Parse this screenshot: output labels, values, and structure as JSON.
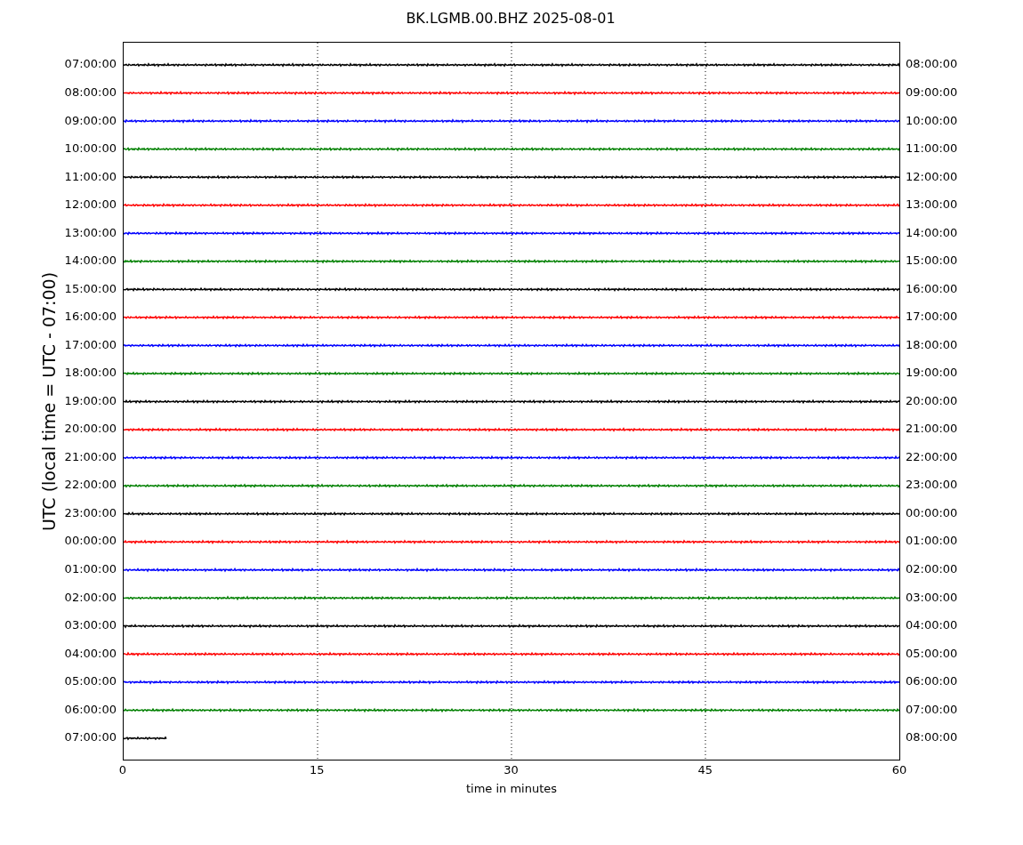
{
  "title": "BK.LGMB.00.BHZ 2025-08-01",
  "ylabel": "UTC (local time = UTC - 07:00)",
  "xlabel": "time in minutes",
  "xticks": [
    "0",
    "15",
    "30",
    "45",
    "60"
  ],
  "traces": [
    {
      "left": "07:00:00",
      "right": "08:00:00",
      "color": "#000000",
      "level": 1
    },
    {
      "left": "08:00:00",
      "right": "09:00:00",
      "color": "#ff0000",
      "level": 1
    },
    {
      "left": "09:00:00",
      "right": "10:00:00",
      "color": "#0000ff",
      "level": 1
    },
    {
      "left": "10:00:00",
      "right": "11:00:00",
      "color": "#008000",
      "level": 1
    },
    {
      "left": "11:00:00",
      "right": "12:00:00",
      "color": "#000000",
      "level": 1
    },
    {
      "left": "12:00:00",
      "right": "13:00:00",
      "color": "#ff0000",
      "level": 1
    },
    {
      "left": "13:00:00",
      "right": "14:00:00",
      "color": "#0000ff",
      "level": 1
    },
    {
      "left": "14:00:00",
      "right": "15:00:00",
      "color": "#008000",
      "level": 1
    },
    {
      "left": "15:00:00",
      "right": "16:00:00",
      "color": "#000000",
      "level": 1
    },
    {
      "left": "16:00:00",
      "right": "17:00:00",
      "color": "#ff0000",
      "level": 1
    },
    {
      "left": "17:00:00",
      "right": "18:00:00",
      "color": "#0000ff",
      "level": 1
    },
    {
      "left": "18:00:00",
      "right": "19:00:00",
      "color": "#008000",
      "level": 1
    },
    {
      "left": "19:00:00",
      "right": "20:00:00",
      "color": "#000000",
      "level": 1
    },
    {
      "left": "20:00:00",
      "right": "21:00:00",
      "color": "#ff0000",
      "level": 1
    },
    {
      "left": "21:00:00",
      "right": "22:00:00",
      "color": "#0000ff",
      "level": 1
    },
    {
      "left": "22:00:00",
      "right": "23:00:00",
      "color": "#008000",
      "level": 1
    },
    {
      "left": "23:00:00",
      "right": "00:00:00",
      "color": "#000000",
      "level": 1
    },
    {
      "left": "00:00:00",
      "right": "01:00:00",
      "color": "#ff0000",
      "level": 1
    },
    {
      "left": "01:00:00",
      "right": "02:00:00",
      "color": "#0000ff",
      "level": 1
    },
    {
      "left": "02:00:00",
      "right": "03:00:00",
      "color": "#008000",
      "level": 1
    },
    {
      "left": "03:00:00",
      "right": "04:00:00",
      "color": "#000000",
      "level": 1
    },
    {
      "left": "04:00:00",
      "right": "05:00:00",
      "color": "#ff0000",
      "level": 1
    },
    {
      "left": "05:00:00",
      "right": "06:00:00",
      "color": "#0000ff",
      "level": 1
    },
    {
      "left": "06:00:00",
      "right": "07:00:00",
      "color": "#008000",
      "level": 1
    },
    {
      "left": "07:00:00",
      "right": "08:00:00",
      "color": "#000000",
      "level": 0.055
    }
  ]
}
